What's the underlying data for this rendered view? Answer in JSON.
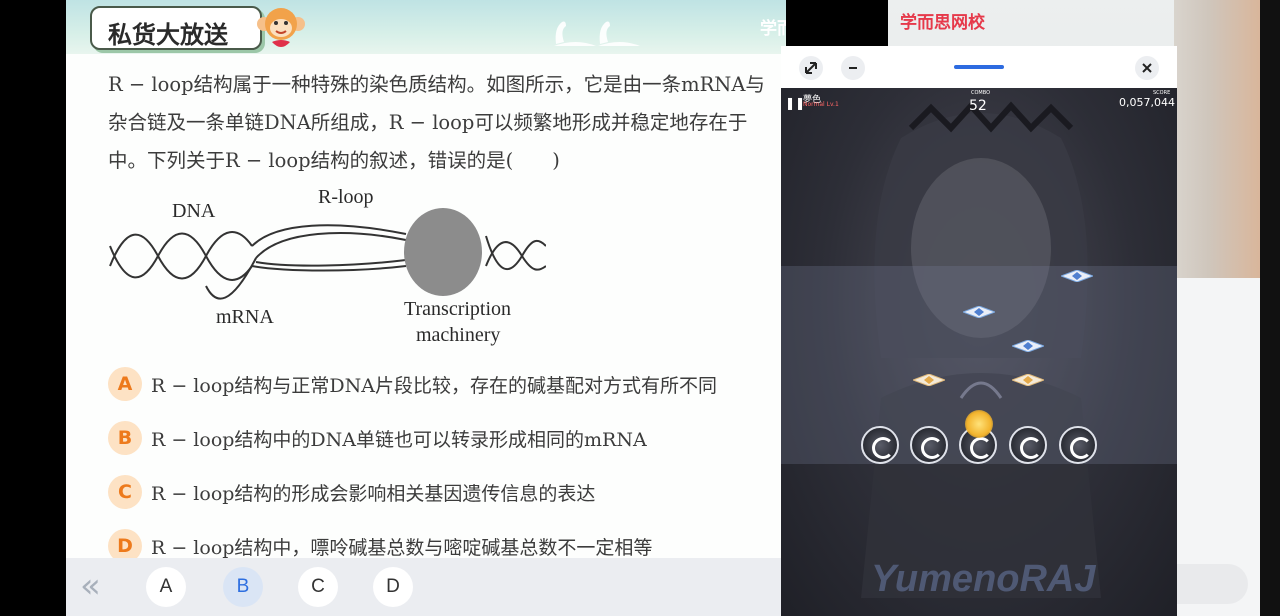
{
  "lesson": {
    "banner_title": "私货大放送",
    "logo_text": "学而思网校",
    "question_lines": [
      "R − loop结构属于一种特殊的染色质结构。如图所示，它是由一条mRNA与",
      "杂合链及一条单链DNA所组成，R − loop可以频繁地形成并稳定地存在于",
      "中。下列关于R − loop结构的叙述，错误的是(　　)"
    ],
    "diagram": {
      "label_dna": "DNA",
      "label_rloop": "R-loop",
      "label_mrna": "mRNA",
      "label_tm1": "Transcription",
      "label_tm2": "machinery"
    },
    "options": [
      {
        "letter": "A",
        "text": "R − loop结构与正常DNA片段比较，存在的碱基配对方式有所不同"
      },
      {
        "letter": "B",
        "text": "R − loop结构中的DNA单链也可以转录形成相同的mRNA"
      },
      {
        "letter": "C",
        "text": "R − loop结构的形成会影响相关基因遗传信息的表达"
      },
      {
        "letter": "D",
        "text": "R − loop结构中，嘌呤碱基总数与嘧啶碱基总数不一定相等"
      }
    ],
    "answer_bar": {
      "back_glyph": "«",
      "choices": [
        "A",
        "B",
        "C",
        "D"
      ],
      "selected": "B"
    }
  },
  "teacher": {
    "logo_text": "学而思网校"
  },
  "game": {
    "hud": {
      "song": "夢色",
      "difficulty": "Normal Lv.1",
      "combo_label": "COMBO",
      "combo": "52",
      "score_label": "SCORE",
      "score": "0,057,044"
    },
    "watermark": "YumenoRAJ"
  }
}
